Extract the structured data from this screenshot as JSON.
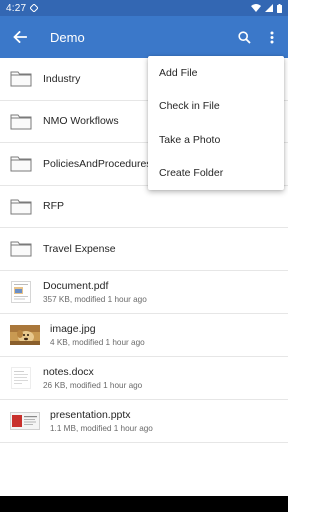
{
  "status_bar": {
    "time": "4:27"
  },
  "app_bar": {
    "title": "Demo",
    "back_icon": "arrow-back-icon",
    "search_icon": "search-icon",
    "more_icon": "more-vert-icon",
    "color": "#3b78c9"
  },
  "folders": [
    {
      "label": "Industry"
    },
    {
      "label": "NMO Workflows"
    },
    {
      "label": "PoliciesAndProcedures"
    },
    {
      "label": "RFP"
    },
    {
      "label": "Travel Expense"
    }
  ],
  "files": [
    {
      "name": "Document.pdf",
      "meta": "357 KB, modified 1 hour ago",
      "thumb": "pdf-thumbnail"
    },
    {
      "name": "image.jpg",
      "meta": "4 KB, modified 1 hour ago",
      "thumb": "dog-photo-thumbnail"
    },
    {
      "name": "notes.docx",
      "meta": "26 KB, modified 1 hour ago",
      "thumb": "docx-thumbnail"
    },
    {
      "name": "presentation.pptx",
      "meta": "1.1 MB, modified 1 hour ago",
      "thumb": "pptx-thumbnail"
    }
  ],
  "overflow_menu": {
    "items": [
      {
        "label": "Add File"
      },
      {
        "label": "Check in File"
      },
      {
        "label": "Take a Photo"
      },
      {
        "label": "Create Folder"
      }
    ]
  }
}
